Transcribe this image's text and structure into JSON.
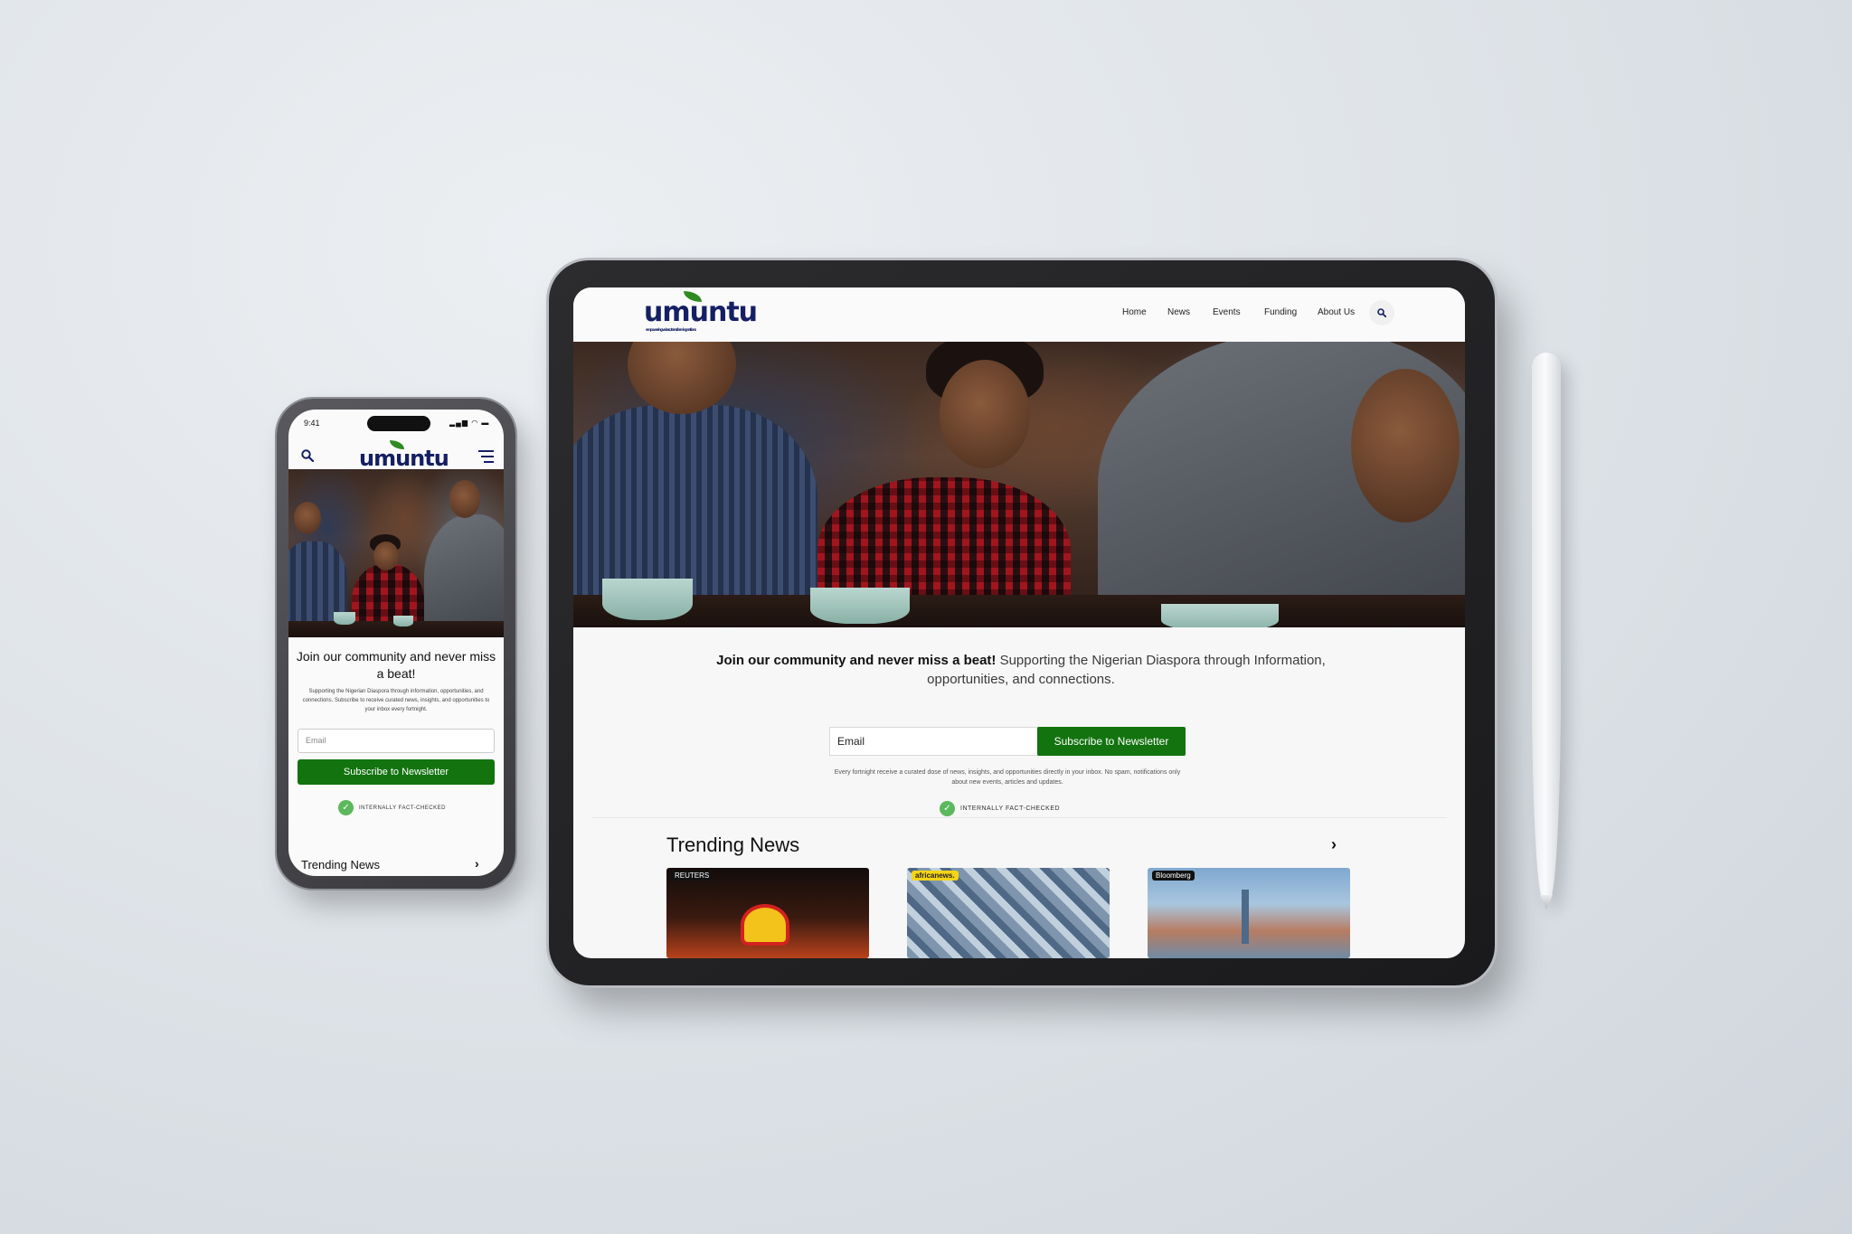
{
  "brand": {
    "logo_text": "umuntu",
    "tagline": "empowering voices, transforming nations",
    "accent_green": "#12730f",
    "logo_navy": "#151f63",
    "leaf_green": "#2f8a22"
  },
  "tablet": {
    "nav": [
      "Home",
      "News",
      "Events",
      "Funding",
      "About Us"
    ],
    "search_icon": "search-icon",
    "hero_alt": "Group of friends talking over coffee",
    "headline_bold": "Join our community and never miss a beat!",
    "headline_rest": " Supporting the Nigerian Diaspora through Information, opportunities, and connections.",
    "email_placeholder": "Email",
    "subscribe_label": "Subscribe to Newsletter",
    "fine_print": "Every fortnight receive a curated dose of news, insights, and opportunities directly in your inbox. No spam, notifications only about new events, articles and updates.",
    "badge_label": "INTERNALLY FACT-CHECKED",
    "trending_title": "Trending News",
    "news_sources": [
      "REUTERS",
      "africanews.",
      "Bloomberg"
    ]
  },
  "phone": {
    "time": "9:41",
    "status": "▂▄▆ ◠ ▬",
    "headline": "Join our community and never miss a beat!",
    "description": "Supporting the Nigerian Diaspora through information, opportunities, and connections. Subscribe to receive curated news, insights, and opportunities to your inbox every fortnight.",
    "email_placeholder": "Email",
    "subscribe_label": "Subscribe to Newsletter",
    "badge_label": "INTERNALLY FACT-CHECKED",
    "trending_title": "Trending News"
  }
}
